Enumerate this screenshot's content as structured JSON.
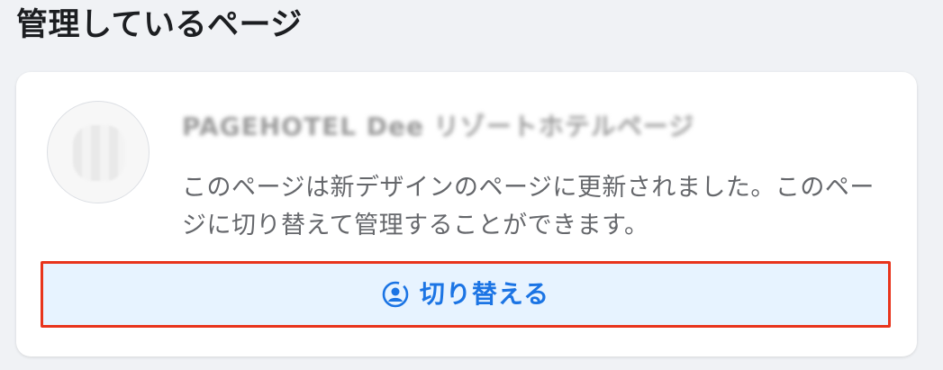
{
  "section": {
    "title": "管理しているページ"
  },
  "page_card": {
    "avatar_icon": "page-avatar-blurred",
    "name": "PAGEHOTEL Dee リゾートホテルページ",
    "description": "このページは新デザインのページに更新されました。このページに切り替えて管理することができます。",
    "switch_button": {
      "label": "切り替える",
      "icon": "switch-profile-icon",
      "text_color": "#1b74e4",
      "background": "#e7f3ff",
      "highlight_border": "#e8341c"
    }
  }
}
